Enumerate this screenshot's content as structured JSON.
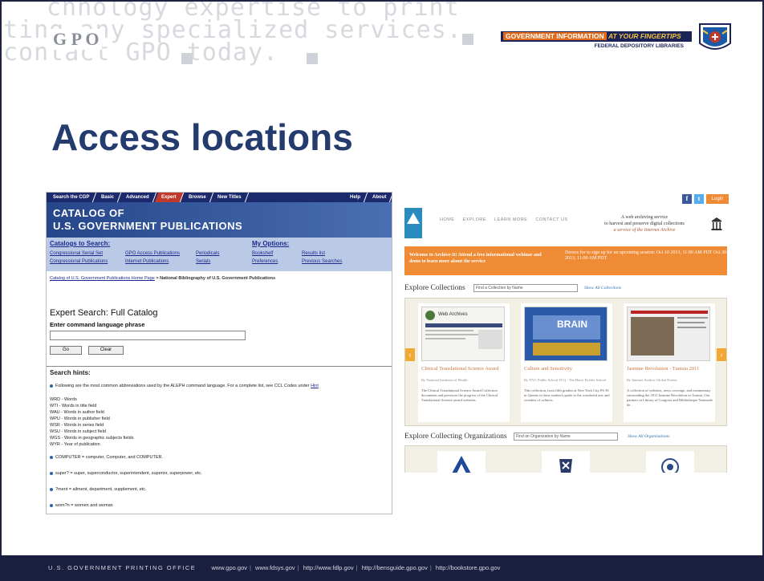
{
  "header": {
    "watermark_lines": [
      "chnology expertise to print",
      "ting any specialized services.",
      "contact GPO today."
    ],
    "gpo_logo": "G P O",
    "banner_title_part1": "GOVERNMENT INFORMATION",
    "banner_title_part2": "AT YOUR FINGERTIPS",
    "banner_subtitle": "FEDERAL DEPOSITORY LIBRARIES"
  },
  "slide": {
    "title": "Access locations"
  },
  "catalog": {
    "nav": [
      "Search the CGP",
      "Basic",
      "Advanced",
      "Expert",
      "Browse",
      "New Titles",
      "Help",
      "About"
    ],
    "active_nav": "Expert",
    "banner_line1": "CATALOG OF",
    "banner_line2": "U.S. GOVERNMENT PUBLICATIONS",
    "catalogs_heading": "Catalogs to Search:",
    "catalogs_links": [
      "Congressional Serial Set",
      "GPO Access Publications",
      "Periodicals",
      "Congressional Publications",
      "Internet Publications",
      "Serials"
    ],
    "options_heading": "My Options:",
    "options_links": [
      "Bookshelf",
      "Results list",
      "Preferences",
      "Previous Searches"
    ],
    "breadcrumb_link": "Catalog of U.S. Government Publications Home Page",
    "breadcrumb_rest": " > National Bibliography of U.S. Government Publications",
    "expert_title": "Expert Search: Full Catalog",
    "command_label": "Enter command language phrase",
    "go_button": "Go",
    "clear_button": "Clear",
    "hints_title": "Search hints:",
    "hint_intro": "Following are the most common abbreviations used by the ALEPH command language. For a complete list, see CCL Codes under",
    "hint_intro_link": "Hint",
    "codes": [
      "WRD - Words",
      "WTI - Words in title field",
      "WAU - Words in author field",
      "WPU - Words in publisher field",
      "WSR - Words in series field",
      "WSU - Words in subject field",
      "WGS - Words in geographic subjects fields",
      "WYR - Year of publication"
    ],
    "examples": [
      "COMPUTER = computer, Computer, and COMPUTER.",
      "super? = super, superconductor, superintendent, superior, superpower, etc.",
      "?ment = ailment, department, supplement, etc.",
      "wom?n = women and woman"
    ]
  },
  "archive": {
    "login": "Login",
    "menu": [
      "HOME",
      "EXPLORE",
      "LEARN MORE",
      "CONTACT US"
    ],
    "tagline1": "A web archiving service",
    "tagline2": "to harvest and preserve digital collections",
    "tagline3": "a service of the Internet Archive",
    "promo_title": "Welcome to Archive-It! Attend a free informational webinar and demo to learn more about the service",
    "promo_right": "Demos for to sign up for an upcoming session: Oct 10 2013, 11:00 AM PDT Oct 30 2013, 11:00 AM PDT",
    "explore_collections": "Explore Collections",
    "find_collection": "Find a Collection by Name",
    "show_all_collections": "Show All Collections",
    "cards": [
      {
        "title": "Clinical Translational Science Award",
        "by": "By National Institutes of Health",
        "desc": "The Clinical Translational Science Award Collection documents and preserves the progress of the Clinical Translational Science award websites."
      },
      {
        "title": "Culture and Sensitivity",
        "by": "By NYC Public School 39 Q - The Harry Eichler School",
        "desc": "This collection, from fifth graders at New York City PS 39 in Queens is these student's guide to the wonderful arts and wonders of cultures."
      },
      {
        "title": "Jasmine Revolution - Tunisia 2011",
        "by": "By Internet Archive Global Events",
        "desc": "A collection of websites, news coverage, and commentary surrounding the 2011 Jasmine Revolution in Tunisia. Our partners at Library of Congress and Bibliotheque Nationale de..."
      }
    ],
    "card1_thumb_text": "Web Archives",
    "card2_thumb_text": "BRAIN",
    "explore_orgs": "Explore Collecting Organizations",
    "find_org": "Find an Organization by Name",
    "show_all_orgs": "Show All Organizations"
  },
  "footer": {
    "org": "U.S. GOVERNMENT PRINTING OFFICE",
    "links": [
      "www.gpo.gov",
      "www.fdsys.gov",
      "http://www.fdlp.gov",
      "http://bensguide.gpo.gov",
      "http://bookstore.gpo.gov"
    ]
  }
}
